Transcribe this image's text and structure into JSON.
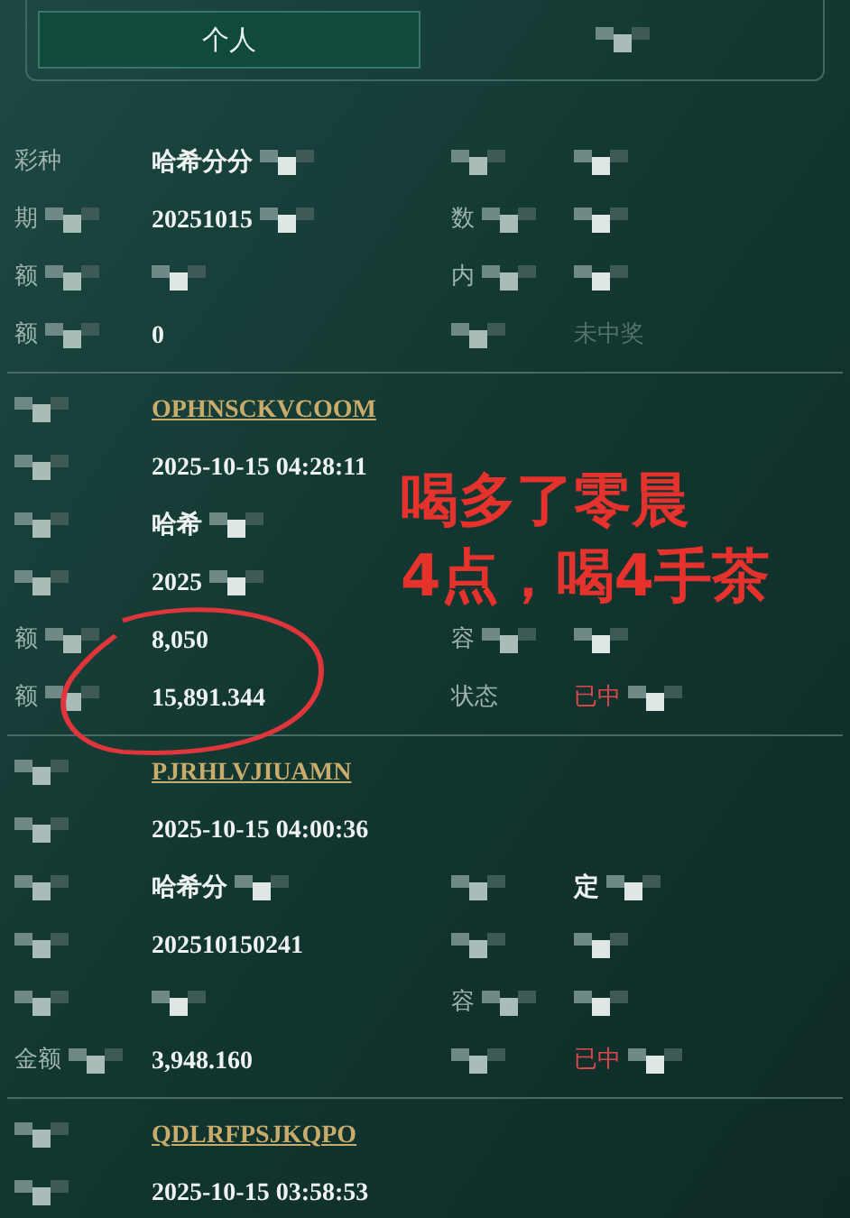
{
  "tabs": [
    {
      "label": "个人",
      "selected": true
    },
    {
      "selected": false
    }
  ],
  "records": [
    {
      "rows": [
        [
          {
            "text": "彩种"
          },
          {
            "text": "哈希分分",
            "masked": true
          },
          {
            "masked": true
          },
          {
            "masked": true
          }
        ],
        [
          {
            "text": "期",
            "masked": true
          },
          {
            "text": "20251015",
            "masked": true
          },
          {
            "text": "数",
            "masked": true
          },
          {
            "masked": true
          }
        ],
        [
          {
            "text": "额",
            "masked": true
          },
          {
            "masked": true
          },
          {
            "text": "内",
            "masked": true
          },
          {
            "masked": true
          }
        ],
        [
          {
            "text": "额",
            "masked": true
          },
          {
            "text": "0"
          },
          {
            "masked": true
          },
          {
            "text": "未中奖",
            "kind": "dim"
          }
        ]
      ]
    },
    {
      "rows": [
        [
          {
            "masked": true
          },
          {
            "text": "OPHNSCKVCOOM",
            "kind": "link"
          },
          {},
          {}
        ],
        [
          {
            "masked": true
          },
          {
            "text": "2025-10-15 04:28:11"
          },
          {},
          {}
        ],
        [
          {
            "masked": true
          },
          {
            "text": "哈希",
            "masked": true
          },
          {},
          {}
        ],
        [
          {
            "masked": true
          },
          {
            "text": "2025",
            "masked": true
          },
          {},
          {}
        ],
        [
          {
            "text": "额",
            "masked": true
          },
          {
            "text": "8,050"
          },
          {
            "text": "容",
            "masked": true
          },
          {
            "masked": true
          }
        ],
        [
          {
            "text": "额",
            "masked": true
          },
          {
            "text": "15,891.344"
          },
          {
            "text": "状态"
          },
          {
            "text": "已中",
            "kind": "won",
            "masked": true
          }
        ]
      ]
    },
    {
      "rows": [
        [
          {
            "masked": true
          },
          {
            "text": "PJRHLVJIUAMN",
            "kind": "link"
          },
          {},
          {}
        ],
        [
          {
            "masked": true
          },
          {
            "text": "2025-10-15 04:00:36"
          },
          {},
          {}
        ],
        [
          {
            "masked": true
          },
          {
            "text": "哈希分",
            "masked": true
          },
          {
            "masked": true
          },
          {
            "text": "定",
            "masked": true
          }
        ],
        [
          {
            "masked": true
          },
          {
            "text": "202510150241"
          },
          {
            "masked": true
          },
          {
            "masked": true
          }
        ],
        [
          {
            "masked": true
          },
          {
            "masked": true
          },
          {
            "text": "容",
            "masked": true
          },
          {
            "masked": true
          }
        ],
        [
          {
            "text": "金额",
            "masked": true
          },
          {
            "text": "3,948.160"
          },
          {
            "masked": true
          },
          {
            "text": "已中",
            "kind": "won",
            "masked": true
          }
        ]
      ]
    },
    {
      "rows": [
        [
          {
            "masked": true
          },
          {
            "text": "QDLRFPSJKQPO",
            "kind": "link"
          },
          {},
          {}
        ],
        [
          {
            "masked": true
          },
          {
            "text": "2025-10-15 03:58:53"
          },
          {},
          {}
        ]
      ]
    }
  ],
  "annotation": {
    "lines": [
      "喝多了零晨",
      "4点，喝4手茶"
    ]
  }
}
